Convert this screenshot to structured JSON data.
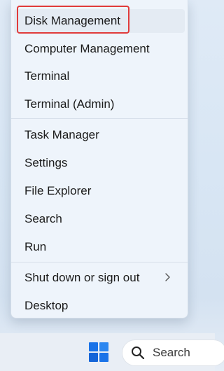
{
  "menu": {
    "items": [
      {
        "label": "Disk Management"
      },
      {
        "label": "Computer Management"
      },
      {
        "label": "Terminal"
      },
      {
        "label": "Terminal (Admin)"
      },
      {
        "label": "Task Manager"
      },
      {
        "label": "Settings"
      },
      {
        "label": "File Explorer"
      },
      {
        "label": "Search"
      },
      {
        "label": "Run"
      },
      {
        "label": "Shut down or sign out"
      },
      {
        "label": "Desktop"
      }
    ]
  },
  "taskbar": {
    "search_label": "Search"
  },
  "colors": {
    "annotation": "#e03b3b",
    "windows_logo": "#1a73e8"
  },
  "icons": {
    "start": "windows-logo-icon",
    "search": "magnifier-icon",
    "submenu": "chevron-right-icon"
  }
}
